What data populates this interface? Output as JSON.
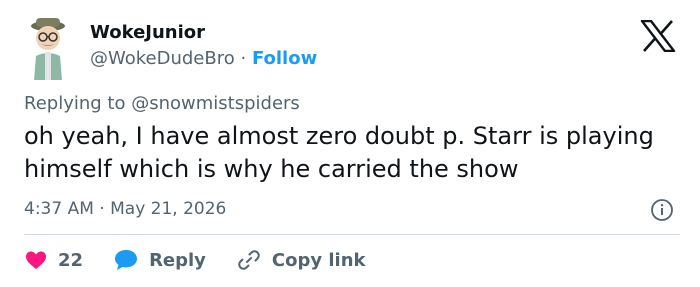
{
  "user": {
    "display_name": "WokeJunior",
    "handle": "@WokeDudeBro",
    "separator": "·",
    "follow_label": "Follow"
  },
  "reply_context": {
    "prefix": "Replying to",
    "mention": "@snowmistspiders"
  },
  "tweet": {
    "text": "oh yeah, I have almost zero doubt p. Starr is playing himself which is why he carried the show",
    "time": "4:37 AM",
    "separator": "·",
    "date": "May 21, 2026"
  },
  "actions": {
    "like_count": "22",
    "reply_label": "Reply",
    "copy_link_label": "Copy link"
  },
  "icons": {
    "brand": "x-logo-icon",
    "info": "info-icon",
    "like": "heart-icon",
    "reply": "speech-bubble-icon",
    "copy": "link-icon"
  },
  "colors": {
    "text": "#0f1419",
    "secondary": "#536471",
    "link": "#1d9bf0",
    "like": "#f91880",
    "reply": "#1d9bf0"
  }
}
